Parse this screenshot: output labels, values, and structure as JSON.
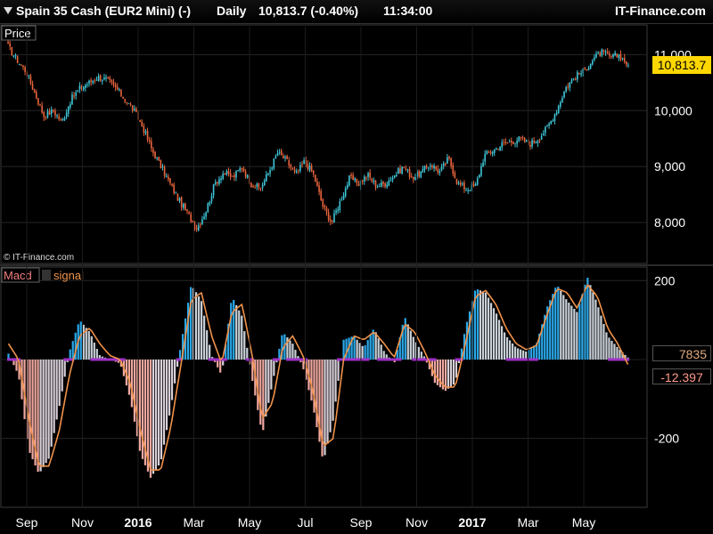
{
  "header": {
    "instrument": "Spain 35 Cash (EUR2 Mini) (-)",
    "period": "Daily",
    "last_value": "10,813.7 (-0.40%)",
    "time": "11:34:00",
    "brand": "IT-Finance.com"
  },
  "price_pane": {
    "label": "Price",
    "copyright": "© IT-Finance.com",
    "current_price_label": "10,813.7"
  },
  "macd_pane": {
    "legend_macd": "Macd",
    "legend_signal": "signal",
    "macd_value_label": "7835",
    "signal_value_label": "-12.397"
  },
  "colors": {
    "bull_candle": "#3ec6d8",
    "bear_candle": "#e8643c",
    "hist_positive_rising": "#2aa8e8",
    "hist_positive_falling": "#c8d0d8",
    "hist_negative_falling": "#f0a8a0",
    "hist_negative_rising": "#d8d0d8",
    "signal_line": "#f0924a",
    "zero_markers": "#a030c8",
    "price_chip": "#ffd700"
  },
  "chart_data": [
    {
      "type": "candlestick",
      "title": "Spain 35 Cash (EUR2 Mini) (-)",
      "x_tick_labels": [
        "Sep",
        "Nov",
        "2016",
        "Mar",
        "May",
        "Jul",
        "Sep",
        "Nov",
        "2017",
        "Mar",
        "May"
      ],
      "y_ticks": [
        8000,
        9000,
        10000,
        11000
      ],
      "y_tick_labels": [
        "8,000",
        "9,000",
        "10,000",
        "11,000"
      ],
      "ylim": [
        7300,
        11500
      ],
      "grid": true,
      "series": [
        {
          "values": [
            11150,
            10900,
            10700,
            10300,
            9900,
            10000,
            9800,
            10200,
            10400,
            10500,
            10600,
            10550,
            10400,
            10200,
            10000,
            9700,
            9300,
            9000,
            8700,
            8400,
            8150,
            7900,
            8200,
            8700,
            8900,
            8800,
            9000,
            8700,
            8600,
            8900,
            9250,
            9100,
            8850,
            9100,
            8850,
            8300,
            8000,
            8400,
            8800,
            8700,
            8850,
            8650,
            8700,
            8850,
            9000,
            8800,
            8900,
            9050,
            8900,
            9150,
            8700,
            8600,
            8650,
            9200,
            9300,
            9400,
            9450,
            9500,
            9400,
            9500,
            9700,
            10000,
            10400,
            10600,
            10700,
            10900,
            11050,
            10950,
            11000,
            10813.7
          ]
        }
      ]
    },
    {
      "type": "bar",
      "title": "Macd",
      "y_ticks": [
        200,
        -200
      ],
      "y_tick_labels": [
        "200",
        "-200"
      ],
      "ylim": [
        -370,
        230
      ],
      "grid": true,
      "series": [
        {
          "name": "Macd",
          "values": [
            15,
            -40,
            -230,
            -290,
            -250,
            -120,
            20,
            100,
            70,
            10,
            0,
            -10,
            -100,
            -240,
            -300,
            -260,
            -120,
            40,
            190,
            150,
            10,
            -40,
            160,
            110,
            -50,
            -190,
            -60,
            70,
            40,
            -20,
            -120,
            -260,
            -150,
            50,
            60,
            30,
            80,
            20,
            -10,
            110,
            50,
            5,
            -60,
            -80,
            -60,
            80,
            180,
            170,
            120,
            60,
            30,
            20,
            40,
            130,
            190,
            150,
            120,
            210,
            140,
            60,
            30,
            5
          ]
        },
        {
          "name": "signal",
          "values": [
            40,
            0,
            -150,
            -270,
            -270,
            -180,
            -40,
            60,
            80,
            40,
            10,
            0,
            -60,
            -180,
            -280,
            -280,
            -170,
            -10,
            150,
            170,
            60,
            -10,
            120,
            140,
            10,
            -150,
            -110,
            30,
            60,
            10,
            -80,
            -220,
            -200,
            0,
            60,
            50,
            70,
            40,
            5,
            90,
            70,
            20,
            -40,
            -70,
            -70,
            40,
            160,
            175,
            140,
            80,
            40,
            25,
            35,
            110,
            180,
            170,
            130,
            190,
            160,
            80,
            40,
            -12.397
          ]
        }
      ]
    }
  ]
}
